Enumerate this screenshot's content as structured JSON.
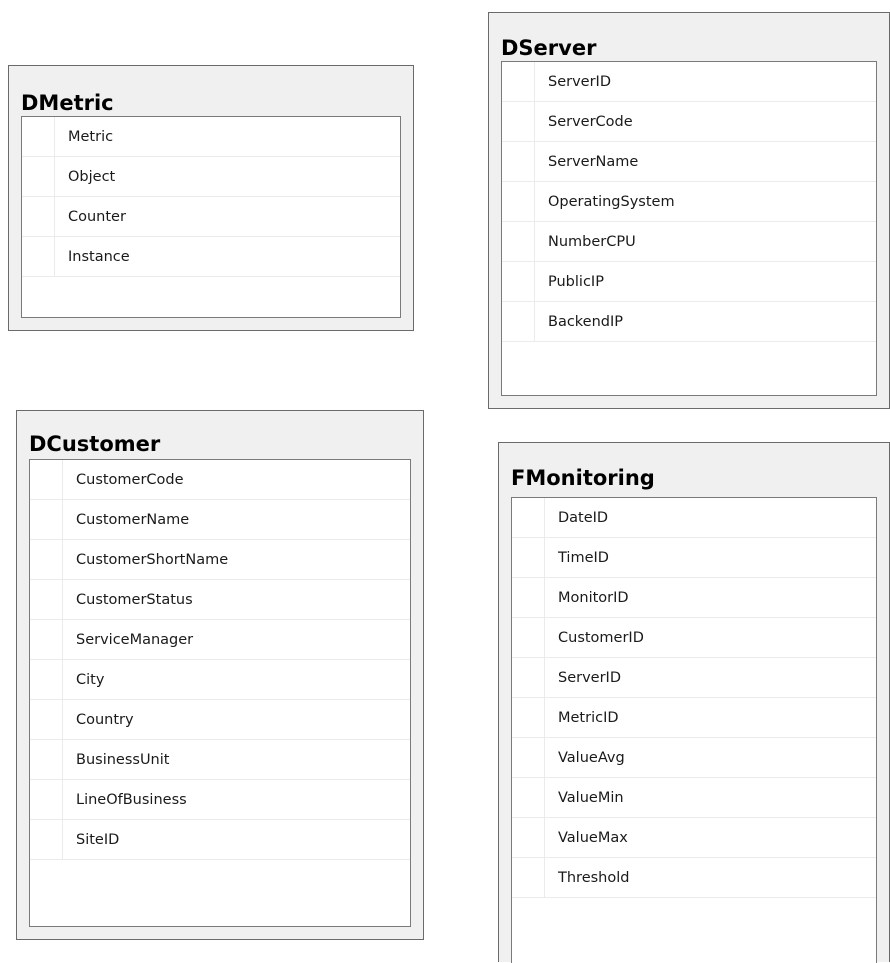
{
  "tables": {
    "dmetric": {
      "title": "DMetric",
      "columns": [
        "Metric",
        "Object",
        "Counter",
        "Instance"
      ]
    },
    "dserver": {
      "title": "DServer",
      "columns": [
        "ServerID",
        "ServerCode",
        "ServerName",
        "OperatingSystem",
        "NumberCPU",
        "PublicIP",
        "BackendIP"
      ]
    },
    "dcustomer": {
      "title": "DCustomer",
      "columns": [
        "CustomerCode",
        "CustomerName",
        "CustomerShortName",
        "CustomerStatus",
        "ServiceManager",
        "City",
        "Country",
        "BusinessUnit",
        "LineOfBusiness",
        "SiteID"
      ]
    },
    "fmonitoring": {
      "title": "FMonitoring",
      "columns": [
        "DateID",
        "TimeID",
        "MonitorID",
        "CustomerID",
        "ServerID",
        "MetricID",
        "ValueAvg",
        "ValueMin",
        "ValueMax",
        "Threshold"
      ]
    }
  }
}
